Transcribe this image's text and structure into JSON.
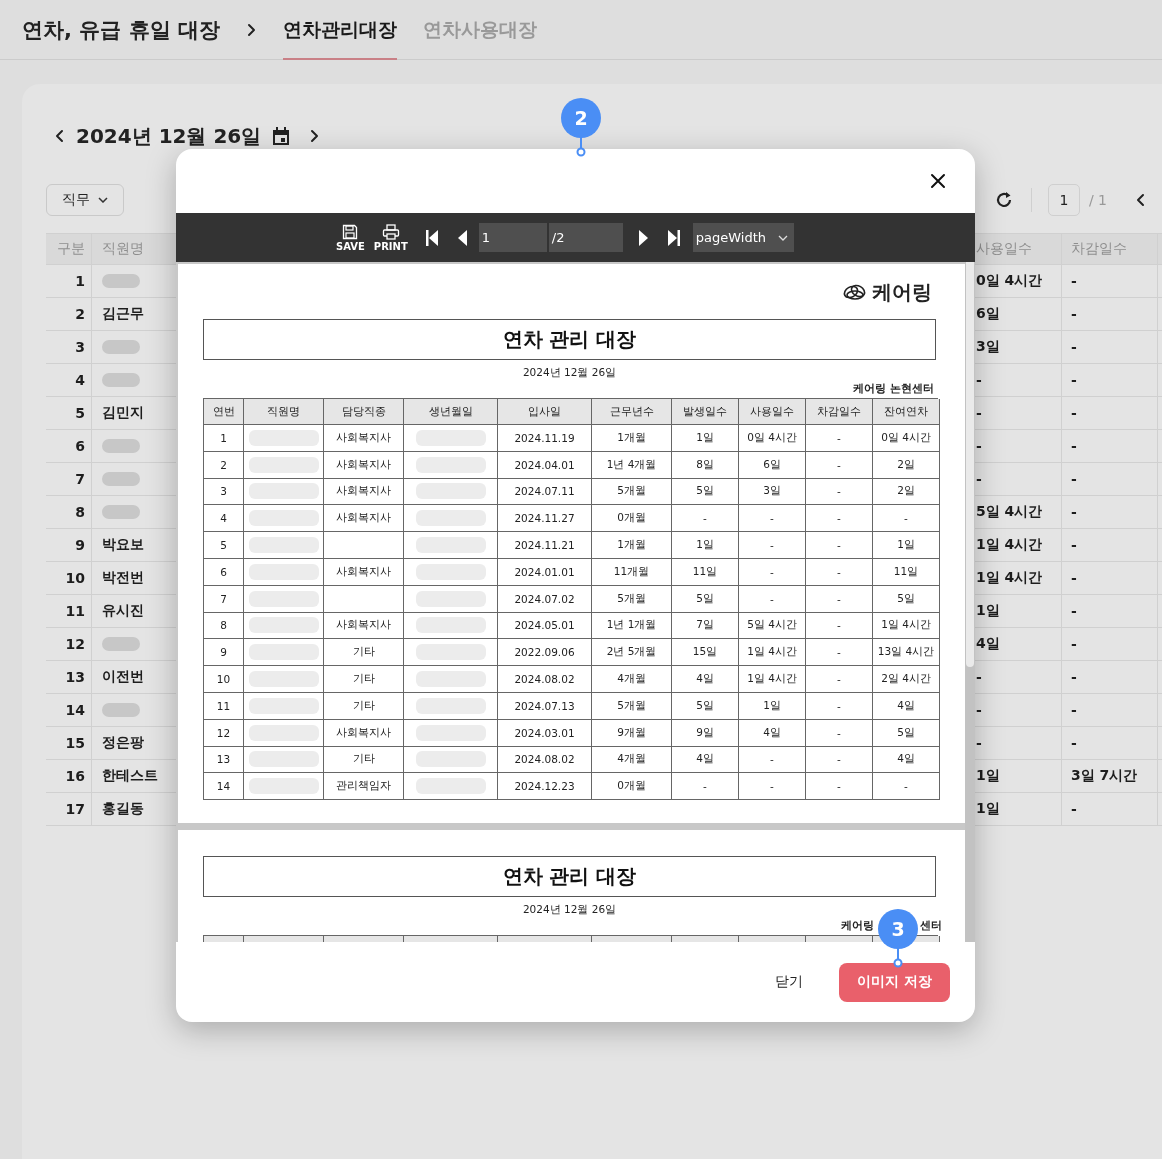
{
  "header": {
    "title": "연차, 유급 휴일 대장",
    "tabs": [
      {
        "label": "연차관리대장",
        "selected": true
      },
      {
        "label": "연차사용대장",
        "selected": false
      }
    ]
  },
  "date_nav": {
    "date": "2024년 12월 26일"
  },
  "filter": {
    "label": "직무"
  },
  "pagination": {
    "page": "1",
    "total": "/ 1"
  },
  "table": {
    "columns": [
      "구분",
      "직원명",
      "사용일수",
      "차감일수"
    ],
    "rows": [
      {
        "no": "1",
        "redacted": true,
        "used": "0일 4시간",
        "deducted": "-"
      },
      {
        "no": "2",
        "redacted": false,
        "name": "김근무",
        "used": "6일",
        "deducted": "-"
      },
      {
        "no": "3",
        "redacted": true,
        "used": "3일",
        "deducted": "-"
      },
      {
        "no": "4",
        "redacted": true,
        "used": "-",
        "deducted": "-"
      },
      {
        "no": "5",
        "redacted": false,
        "name": "김민지",
        "used": "-",
        "deducted": "-"
      },
      {
        "no": "6",
        "redacted": true,
        "used": "-",
        "deducted": "-"
      },
      {
        "no": "7",
        "redacted": true,
        "used": "-",
        "deducted": "-"
      },
      {
        "no": "8",
        "redacted": true,
        "used": "5일 4시간",
        "deducted": "-"
      },
      {
        "no": "9",
        "redacted": false,
        "name": "박요보",
        "used": "1일 4시간",
        "deducted": "-"
      },
      {
        "no": "10",
        "redacted": false,
        "name": "박전번",
        "used": "1일 4시간",
        "deducted": "-"
      },
      {
        "no": "11",
        "redacted": false,
        "name": "유시진",
        "used": "1일",
        "deducted": "-"
      },
      {
        "no": "12",
        "redacted": true,
        "used": "4일",
        "deducted": "-"
      },
      {
        "no": "13",
        "redacted": false,
        "name": "이전번",
        "used": "-",
        "deducted": "-"
      },
      {
        "no": "14",
        "redacted": true,
        "used": "-",
        "deducted": "-"
      },
      {
        "no": "15",
        "redacted": false,
        "name": "정은팡",
        "used": "-",
        "deducted": "-"
      },
      {
        "no": "16",
        "redacted": false,
        "name": "한테스트",
        "used": "1일",
        "deducted": "3일 7시간"
      },
      {
        "no": "17",
        "redacted": false,
        "name": "홍길동",
        "used": "1일",
        "deducted": "-"
      }
    ]
  },
  "modal": {
    "toolbar": {
      "save": "SAVE",
      "print": "PRINT",
      "page": "1",
      "page_total": "/2",
      "zoom": "pageWidth"
    },
    "document": {
      "logo": "케어링",
      "pages": [
        {
          "title": "연차 관리 대장",
          "date": "2024년 12월 26일",
          "center": "케어링 논현센터",
          "columns": [
            "연번",
            "직원명",
            "담당직종",
            "생년월일",
            "입사일",
            "근무년수",
            "발생일수",
            "사용일수",
            "차감일수",
            "잔여연차"
          ],
          "rows": [
            {
              "no": "1",
              "redacted": true,
              "role": "사회복지사",
              "hired": "2024.11.19",
              "tenure": "1개월",
              "granted": "1일",
              "used": "0일 4시간",
              "deducted": "-",
              "remaining": "0일 4시간"
            },
            {
              "no": "2",
              "redacted": true,
              "role": "사회복지사",
              "hired": "2024.04.01",
              "tenure": "1년 4개월",
              "granted": "8일",
              "used": "6일",
              "deducted": "-",
              "remaining": "2일"
            },
            {
              "no": "3",
              "redacted": true,
              "role": "사회복지사",
              "hired": "2024.07.11",
              "tenure": "5개월",
              "granted": "5일",
              "used": "3일",
              "deducted": "-",
              "remaining": "2일"
            },
            {
              "no": "4",
              "redacted": true,
              "role": "사회복지사",
              "hired": "2024.11.27",
              "tenure": "0개월",
              "granted": "-",
              "used": "-",
              "deducted": "-",
              "remaining": "-"
            },
            {
              "no": "5",
              "redacted": true,
              "hired": "2024.11.21",
              "tenure": "1개월",
              "granted": "1일",
              "used": "-",
              "deducted": "-",
              "remaining": "1일"
            },
            {
              "no": "6",
              "redacted": true,
              "role": "사회복지사",
              "hired": "2024.01.01",
              "tenure": "11개월",
              "granted": "11일",
              "used": "-",
              "deducted": "-",
              "remaining": "11일"
            },
            {
              "no": "7",
              "redacted": true,
              "hired": "2024.07.02",
              "tenure": "5개월",
              "granted": "5일",
              "used": "-",
              "deducted": "-",
              "remaining": "5일"
            },
            {
              "no": "8",
              "redacted": true,
              "role": "사회복지사",
              "hired": "2024.05.01",
              "tenure": "1년 1개월",
              "granted": "7일",
              "used": "5일 4시간",
              "deducted": "-",
              "remaining": "1일 4시간"
            },
            {
              "no": "9",
              "redacted": true,
              "role": "기타",
              "hired": "2022.09.06",
              "tenure": "2년 5개월",
              "granted": "15일",
              "used": "1일 4시간",
              "deducted": "-",
              "remaining": "13일 4시간"
            },
            {
              "no": "10",
              "redacted": true,
              "role": "기타",
              "hired": "2024.08.02",
              "tenure": "4개월",
              "granted": "4일",
              "used": "1일 4시간",
              "deducted": "-",
              "remaining": "2일 4시간"
            },
            {
              "no": "11",
              "redacted": true,
              "role": "기타",
              "hired": "2024.07.13",
              "tenure": "5개월",
              "granted": "5일",
              "used": "1일",
              "deducted": "-",
              "remaining": "4일"
            },
            {
              "no": "12",
              "redacted": true,
              "role": "사회복지사",
              "hired": "2024.03.01",
              "tenure": "9개월",
              "granted": "9일",
              "used": "4일",
              "deducted": "-",
              "remaining": "5일"
            },
            {
              "no": "13",
              "redacted": true,
              "role": "기타",
              "hired": "2024.08.02",
              "tenure": "4개월",
              "granted": "4일",
              "used": "-",
              "deducted": "-",
              "remaining": "4일"
            },
            {
              "no": "14",
              "redacted": true,
              "role": "관리책임자",
              "hired": "2024.12.23",
              "tenure": "0개월",
              "granted": "-",
              "used": "-",
              "deducted": "-",
              "remaining": "-"
            }
          ]
        },
        {
          "title": "연차 관리 대장",
          "date": "2024년 12월 26일",
          "center_parts": [
            "케어링",
            "센터"
          ]
        }
      ]
    },
    "footer": {
      "buttons": [
        {
          "label": "닫기",
          "kind": "text"
        },
        {
          "label": "이미지 저장",
          "kind": "primary"
        }
      ]
    }
  },
  "markers": [
    {
      "label": "2"
    },
    {
      "label": "3"
    }
  ]
}
